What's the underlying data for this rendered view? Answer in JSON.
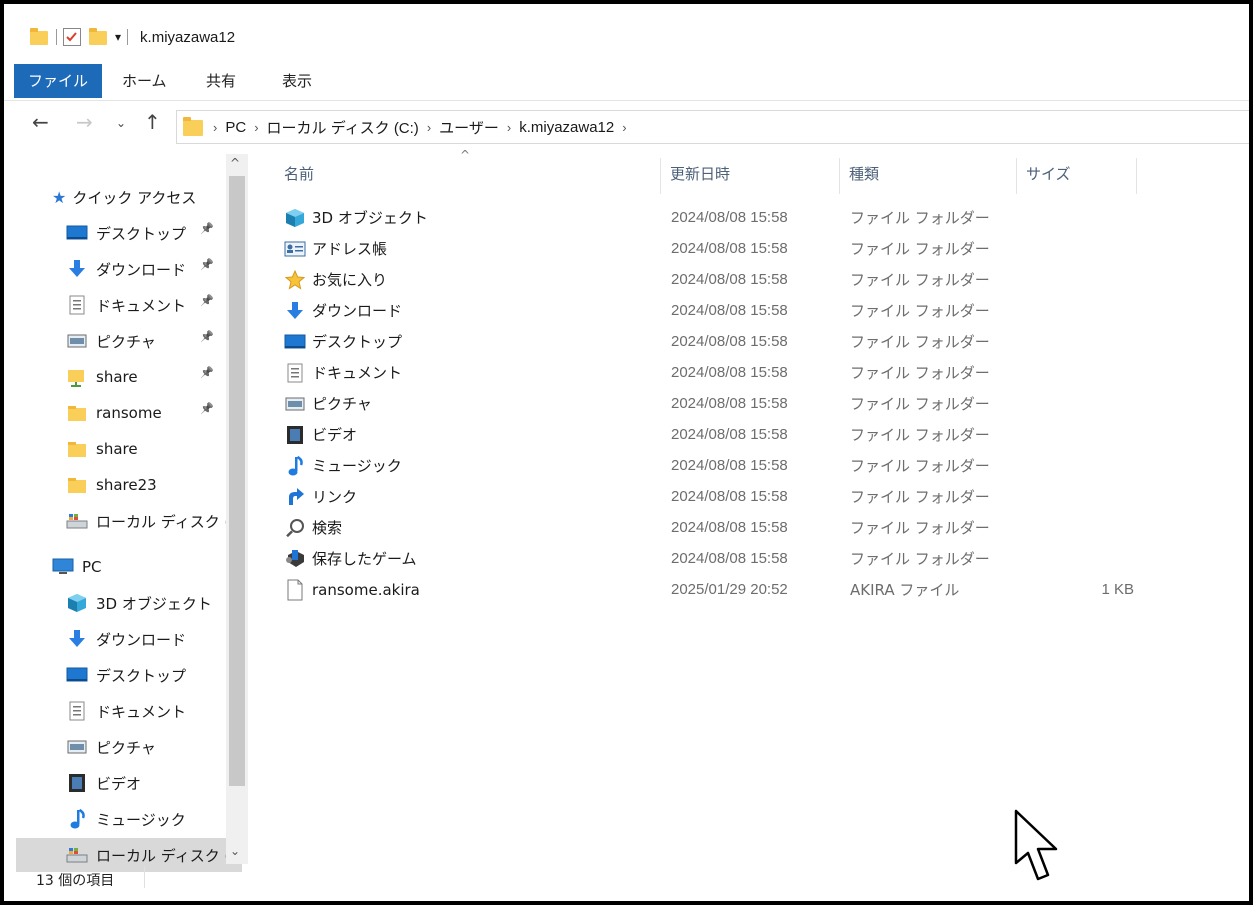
{
  "window": {
    "title": "k.miyazawa12"
  },
  "ribbon": {
    "tabs": [
      "ファイル",
      "ホーム",
      "共有",
      "表示"
    ]
  },
  "address": {
    "crumbs": [
      "PC",
      "ローカル ディスク (C:)",
      "ユーザー",
      "k.miyazawa12"
    ]
  },
  "sidebar": {
    "quick_access_label": "クイック アクセス",
    "quick_items": [
      {
        "label": "デスクトップ",
        "icon": "desktop-icon",
        "pinned": true
      },
      {
        "label": "ダウンロード",
        "icon": "download-icon",
        "pinned": true
      },
      {
        "label": "ドキュメント",
        "icon": "document-icon",
        "pinned": true
      },
      {
        "label": "ピクチャ",
        "icon": "picture-icon",
        "pinned": true
      },
      {
        "label": "share",
        "icon": "network-folder-icon",
        "pinned": true
      },
      {
        "label": "ransome",
        "icon": "folder-icon",
        "pinned": true
      },
      {
        "label": "share",
        "icon": "folder-icon",
        "pinned": false
      },
      {
        "label": "share23",
        "icon": "folder-icon",
        "pinned": false
      },
      {
        "label": "ローカル ディスク (C",
        "icon": "drive-icon",
        "pinned": false
      }
    ],
    "pc_label": "PC",
    "pc_items": [
      {
        "label": "3D オブジェクト",
        "icon": "3d-object-icon"
      },
      {
        "label": "ダウンロード",
        "icon": "download-icon"
      },
      {
        "label": "デスクトップ",
        "icon": "desktop-icon"
      },
      {
        "label": "ドキュメント",
        "icon": "document-icon"
      },
      {
        "label": "ピクチャ",
        "icon": "picture-icon"
      },
      {
        "label": "ビデオ",
        "icon": "video-icon"
      },
      {
        "label": "ミュージック",
        "icon": "music-icon"
      },
      {
        "label": "ローカル ディスク (C",
        "icon": "drive-icon"
      }
    ]
  },
  "columns": {
    "name": "名前",
    "date": "更新日時",
    "type": "種類",
    "size": "サイズ"
  },
  "files": [
    {
      "name": "3D オブジェクト",
      "date": "2024/08/08 15:58",
      "type": "ファイル フォルダー",
      "size": "",
      "icon": "3d-object-icon"
    },
    {
      "name": "アドレス帳",
      "date": "2024/08/08 15:58",
      "type": "ファイル フォルダー",
      "size": "",
      "icon": "contacts-icon"
    },
    {
      "name": "お気に入り",
      "date": "2024/08/08 15:58",
      "type": "ファイル フォルダー",
      "size": "",
      "icon": "star-icon"
    },
    {
      "name": "ダウンロード",
      "date": "2024/08/08 15:58",
      "type": "ファイル フォルダー",
      "size": "",
      "icon": "download-icon"
    },
    {
      "name": "デスクトップ",
      "date": "2024/08/08 15:58",
      "type": "ファイル フォルダー",
      "size": "",
      "icon": "desktop-icon"
    },
    {
      "name": "ドキュメント",
      "date": "2024/08/08 15:58",
      "type": "ファイル フォルダー",
      "size": "",
      "icon": "document-icon"
    },
    {
      "name": "ピクチャ",
      "date": "2024/08/08 15:58",
      "type": "ファイル フォルダー",
      "size": "",
      "icon": "picture-icon"
    },
    {
      "name": "ビデオ",
      "date": "2024/08/08 15:58",
      "type": "ファイル フォルダー",
      "size": "",
      "icon": "video-icon"
    },
    {
      "name": "ミュージック",
      "date": "2024/08/08 15:58",
      "type": "ファイル フォルダー",
      "size": "",
      "icon": "music-icon"
    },
    {
      "name": "リンク",
      "date": "2024/08/08 15:58",
      "type": "ファイル フォルダー",
      "size": "",
      "icon": "link-icon"
    },
    {
      "name": "検索",
      "date": "2024/08/08 15:58",
      "type": "ファイル フォルダー",
      "size": "",
      "icon": "search-icon"
    },
    {
      "name": "保存したゲーム",
      "date": "2024/08/08 15:58",
      "type": "ファイル フォルダー",
      "size": "",
      "icon": "saved-games-icon"
    },
    {
      "name": "ransome.akira",
      "date": "2025/01/29 20:52",
      "type": "AKIRA ファイル",
      "size": "1 KB",
      "icon": "file-icon"
    }
  ],
  "status": {
    "item_count": "13 個の項目"
  },
  "colors": {
    "accent": "#1d6ab8",
    "selected": "#d9d9d9",
    "header_text": "#4c607a"
  }
}
